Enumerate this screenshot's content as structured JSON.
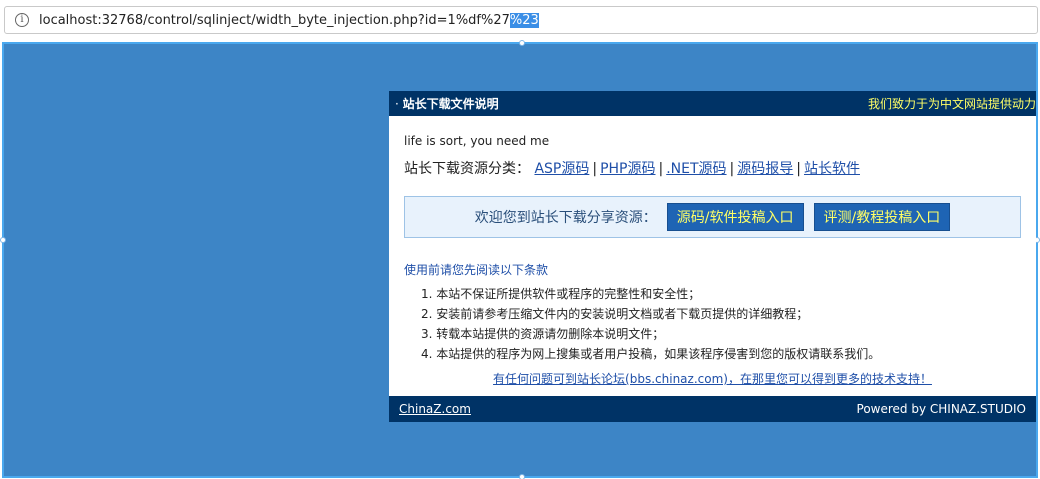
{
  "addressbar": {
    "info_icon": "info-icon",
    "url_plain": "localhost:32768/control/sqlinject/width_byte_injection.php?id=1%df%27",
    "url_selected": "%23"
  },
  "panel": {
    "header": {
      "bullet": "·",
      "title": "站长下载文件说明",
      "slogan": "我们致力于为中文网站提供动力"
    },
    "tagline": "life is sort, you need me",
    "categories": {
      "label": "站长下载资源分类：",
      "links": [
        "ASP源码",
        "PHP源码",
        ".NET源码",
        "源码报导",
        "站长软件"
      ],
      "separator": "|"
    },
    "welcome": {
      "text": "欢迎您到站长下载分享资源：",
      "buttons": [
        "源码/软件投稿入口",
        "评测/教程投稿入口"
      ]
    },
    "rules": {
      "title": "使用前请您先阅读以下条款",
      "items": [
        "1. 本站不保证所提供软件或程序的完整性和安全性；",
        "2. 安装前请参考压缩文件内的安装说明文档或者下载页提供的详细教程；",
        "3. 转载本站提供的资源请勿删除本说明文件；",
        "4. 本站提供的程序为网上搜集或者用户投稿，如果该程序侵害到您的版权请联系我们。"
      ]
    },
    "help_link": "有任何问题可到站长论坛(bbs.chinaz.com)，在那里您可以得到更多的技术支持！",
    "footer": {
      "left_link": "ChinaZ.com",
      "right_text": "Powered by CHINAZ.STUDIO"
    }
  },
  "colors": {
    "stage_bg": "#3d85c6",
    "panel_header": "#003366",
    "slogan": "#ffff66",
    "link": "#1f4fa8"
  }
}
